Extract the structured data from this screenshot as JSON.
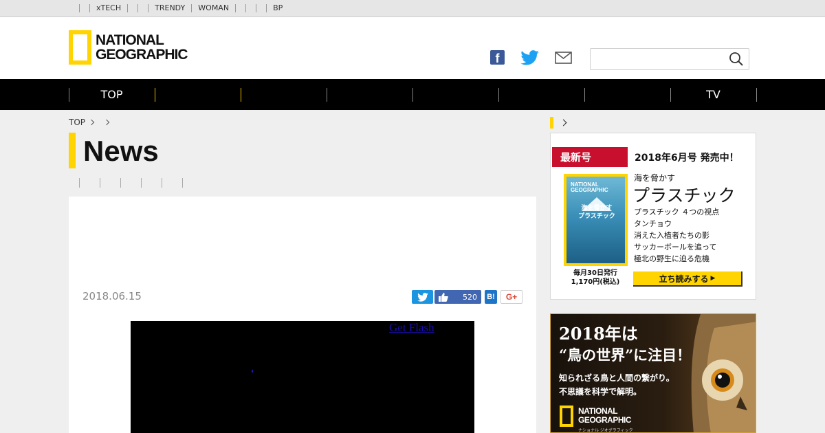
{
  "topbar": {
    "links": [
      "",
      "xTECH",
      "",
      "",
      "TRENDY",
      "WOMAN",
      "",
      "",
      "",
      "BP"
    ]
  },
  "header": {
    "logo_text": "NATIONAL\nGEOGRAPHIC",
    "search_placeholder": ""
  },
  "nav": {
    "items": [
      "TOP",
      "",
      "",
      "",
      "",
      "",
      "",
      "TV"
    ]
  },
  "breadcrumb": {
    "home": "TOP"
  },
  "page": {
    "title": "News"
  },
  "article": {
    "date": "2018.06.15",
    "share": {
      "like_count": "520",
      "hatena": "B!",
      "gplus": "G+"
    },
    "video": {
      "flash_link": "Get Flash"
    }
  },
  "magazine": {
    "badge": "最新号",
    "issue": "2018年6月号 発売中！",
    "lead": "海を脅かす",
    "headline": "プラスチック",
    "toc": [
      "プラスチック ４つの視点",
      "タンチョウ",
      "消えた入植者たちの影",
      "サッカーボールを追って",
      "極北の野生に迫る危機"
    ],
    "publish_line1": "毎月30日発行",
    "publish_line2": "1,170円(税込)",
    "read_button": "立ち読みする",
    "cover_logo": "NATIONAL\nGEOGRAPHIC",
    "cover_title": "海を脅かす\nプラスチック"
  },
  "ad": {
    "headline1": "2018年は",
    "headline2": "“鳥の世界”に注目！",
    "body1": "知られざる鳥と人間の繋がり。",
    "body2": "不思議を科学で解明。",
    "logo": "NATIONAL\nGEOGRAPHIC",
    "logo_sub": "ナショナル ジオグラフィック日本版"
  },
  "colors": {
    "accent": "#ffd400",
    "nav_bg": "#000000",
    "badge_red": "#c8102e",
    "twitter": "#1c95e0",
    "facebook": "#4267b2"
  }
}
